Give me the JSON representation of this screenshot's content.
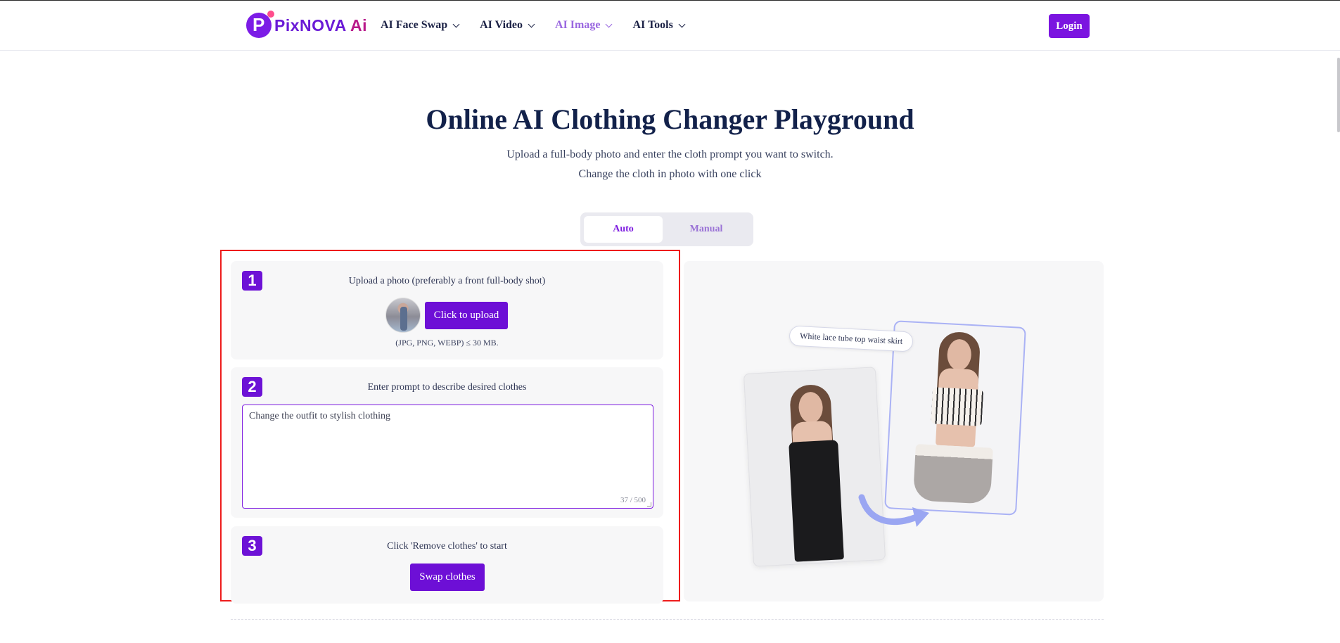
{
  "brand": {
    "name_main": "PixNOVA",
    "name_ai": " Ai"
  },
  "nav": {
    "items": [
      {
        "label": "AI Face Swap"
      },
      {
        "label": "AI Video"
      },
      {
        "label": "AI Image"
      },
      {
        "label": "AI Tools"
      }
    ],
    "login_label": "Login"
  },
  "hero": {
    "title": "Online AI Clothing Changer Playground",
    "subtitle_line1": "Upload a full-body photo and enter the cloth prompt you want to switch.",
    "subtitle_line2": "Change the cloth in photo with one click"
  },
  "mode_tabs": {
    "auto": "Auto",
    "manual": "Manual",
    "selected": "Auto"
  },
  "steps": {
    "step1": {
      "number": "1",
      "title": "Upload a photo (preferably a front full-body shot)",
      "upload_label": "Click to upload",
      "hint": "(JPG, PNG, WEBP) ≤ 30 MB."
    },
    "step2": {
      "number": "2",
      "title": "Enter prompt to describe desired clothes",
      "prompt_value": "Change the outfit to stylish clothing",
      "counter": "37 / 500"
    },
    "step3": {
      "number": "3",
      "title": "Click 'Remove clothes' to start",
      "button_label": "Swap clothes"
    }
  },
  "preview": {
    "tag_text": "White lace tube top waist skirt"
  },
  "colors": {
    "accent": "#6d0fd6",
    "highlight_border": "#ee1c1c",
    "nav_active": "#9a68e0"
  }
}
